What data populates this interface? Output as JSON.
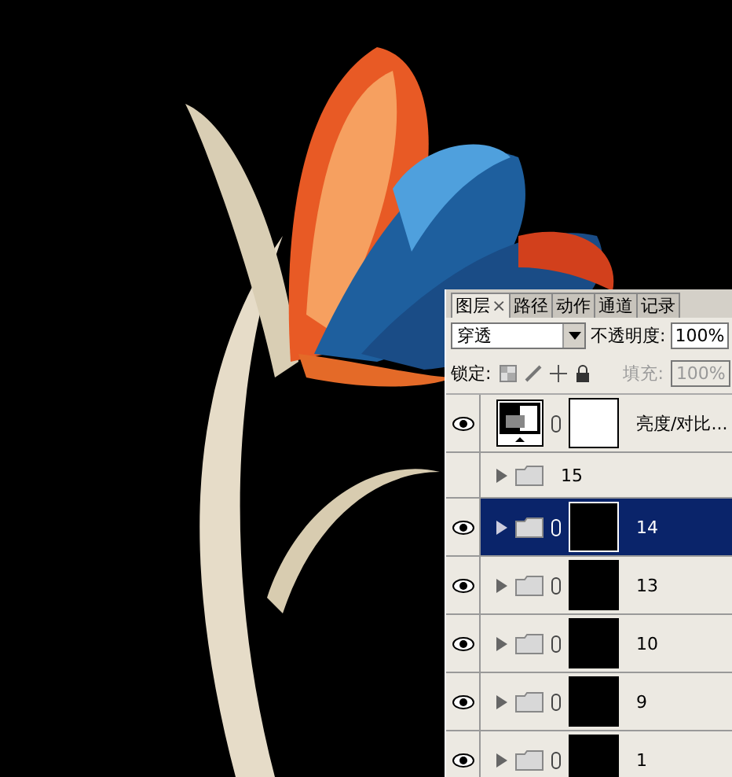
{
  "panel": {
    "tabs": [
      {
        "label": "图层",
        "selected": true,
        "close": "×"
      },
      {
        "label": "路径",
        "selected": false
      },
      {
        "label": "动作",
        "selected": false
      },
      {
        "label": "通道",
        "selected": false
      },
      {
        "label": "记录",
        "selected": false
      }
    ],
    "blend_mode": "穿透",
    "opacity_label": "不透明度:",
    "opacity": "100%",
    "lock_label": "锁定:",
    "fill_label": "填充:",
    "fill": "100%",
    "layers": [
      {
        "kind": "adjustment",
        "name": "亮度/对比...",
        "visible": true,
        "selected": false,
        "mask": true
      },
      {
        "kind": "group",
        "name": "15",
        "visible": false,
        "selected": false,
        "mask": false
      },
      {
        "kind": "group",
        "name": "14",
        "visible": true,
        "selected": true,
        "mask": true
      },
      {
        "kind": "group",
        "name": "13",
        "visible": true,
        "selected": false,
        "mask": true
      },
      {
        "kind": "group",
        "name": "10",
        "visible": true,
        "selected": false,
        "mask": true
      },
      {
        "kind": "group",
        "name": "9",
        "visible": true,
        "selected": false,
        "mask": true
      },
      {
        "kind": "group",
        "name": "1",
        "visible": true,
        "selected": false,
        "mask": true
      }
    ]
  }
}
